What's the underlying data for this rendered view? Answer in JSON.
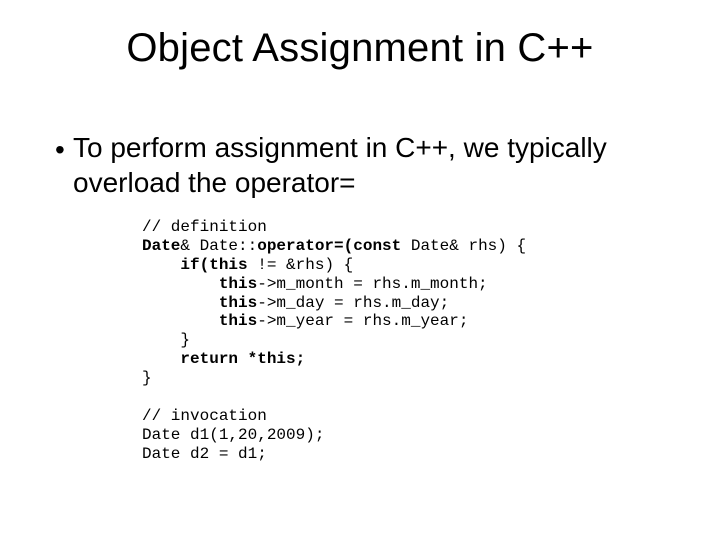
{
  "title": "Object Assignment in C++",
  "bullet": {
    "marker": "•",
    "text": "To perform assignment in C++, we typically overload the operator="
  },
  "code": {
    "c1": "// definition",
    "l2a": "Date",
    "l2b": "& Date::",
    "l2c": "operator=(const",
    "l2d": " Date& rhs) {",
    "l3a": "    ",
    "l3b": "if(this",
    "l3c": " != &rhs) {",
    "l4a": "        ",
    "l4b": "this",
    "l4c": "->m_month = rhs.m_month;",
    "l5a": "        ",
    "l5b": "this",
    "l5c": "->m_day = rhs.m_day;",
    "l6a": "        ",
    "l6b": "this",
    "l6c": "->m_year = rhs.m_year;",
    "l7": "    }",
    "l8a": "    ",
    "l8b": "return *this;",
    "l9": "}",
    "blank": "",
    "c2": "// invocation",
    "l11": "Date d1(1,20,2009);",
    "l12": "Date d2 = d1;"
  }
}
